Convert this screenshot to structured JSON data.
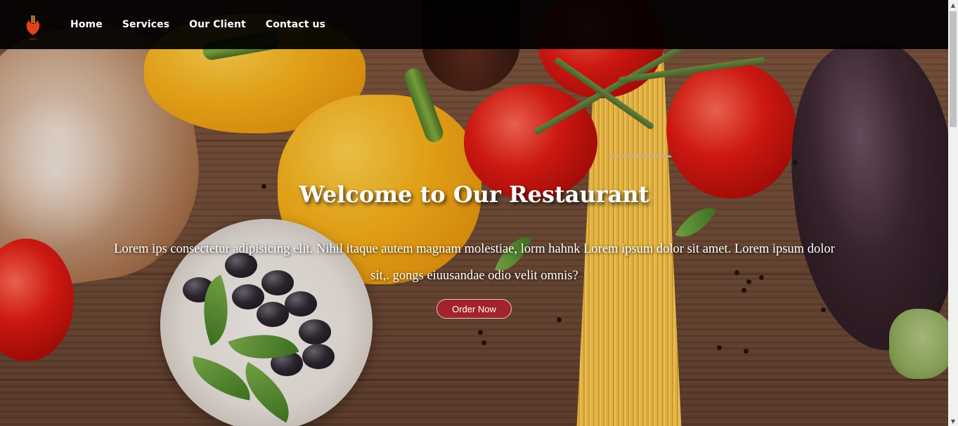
{
  "nav": {
    "logo_icon": "restaurant-logo-icon",
    "items": [
      {
        "label": "Home"
      },
      {
        "label": "Services"
      },
      {
        "label": "Our Client"
      },
      {
        "label": "Contact us"
      }
    ]
  },
  "hero": {
    "title": "Welcome to Our Restaurant",
    "description": "Lorem ips consectetur adipisicing elit. Nihil itaque autem magnam molestiae, lorm hahnk Lorem ipsum dolor sit amet. Lorem ipsum dolor sit,. gongs eiuusandae odio velit omnis?",
    "order_button": "Order Now"
  },
  "colors": {
    "navbar_bg": "#000000",
    "button_bg": "#a3232a",
    "text": "#ffffff",
    "logo_accent": "#e0431b"
  },
  "icons": {
    "scroll_up": "▲",
    "scroll_down": "▼"
  }
}
